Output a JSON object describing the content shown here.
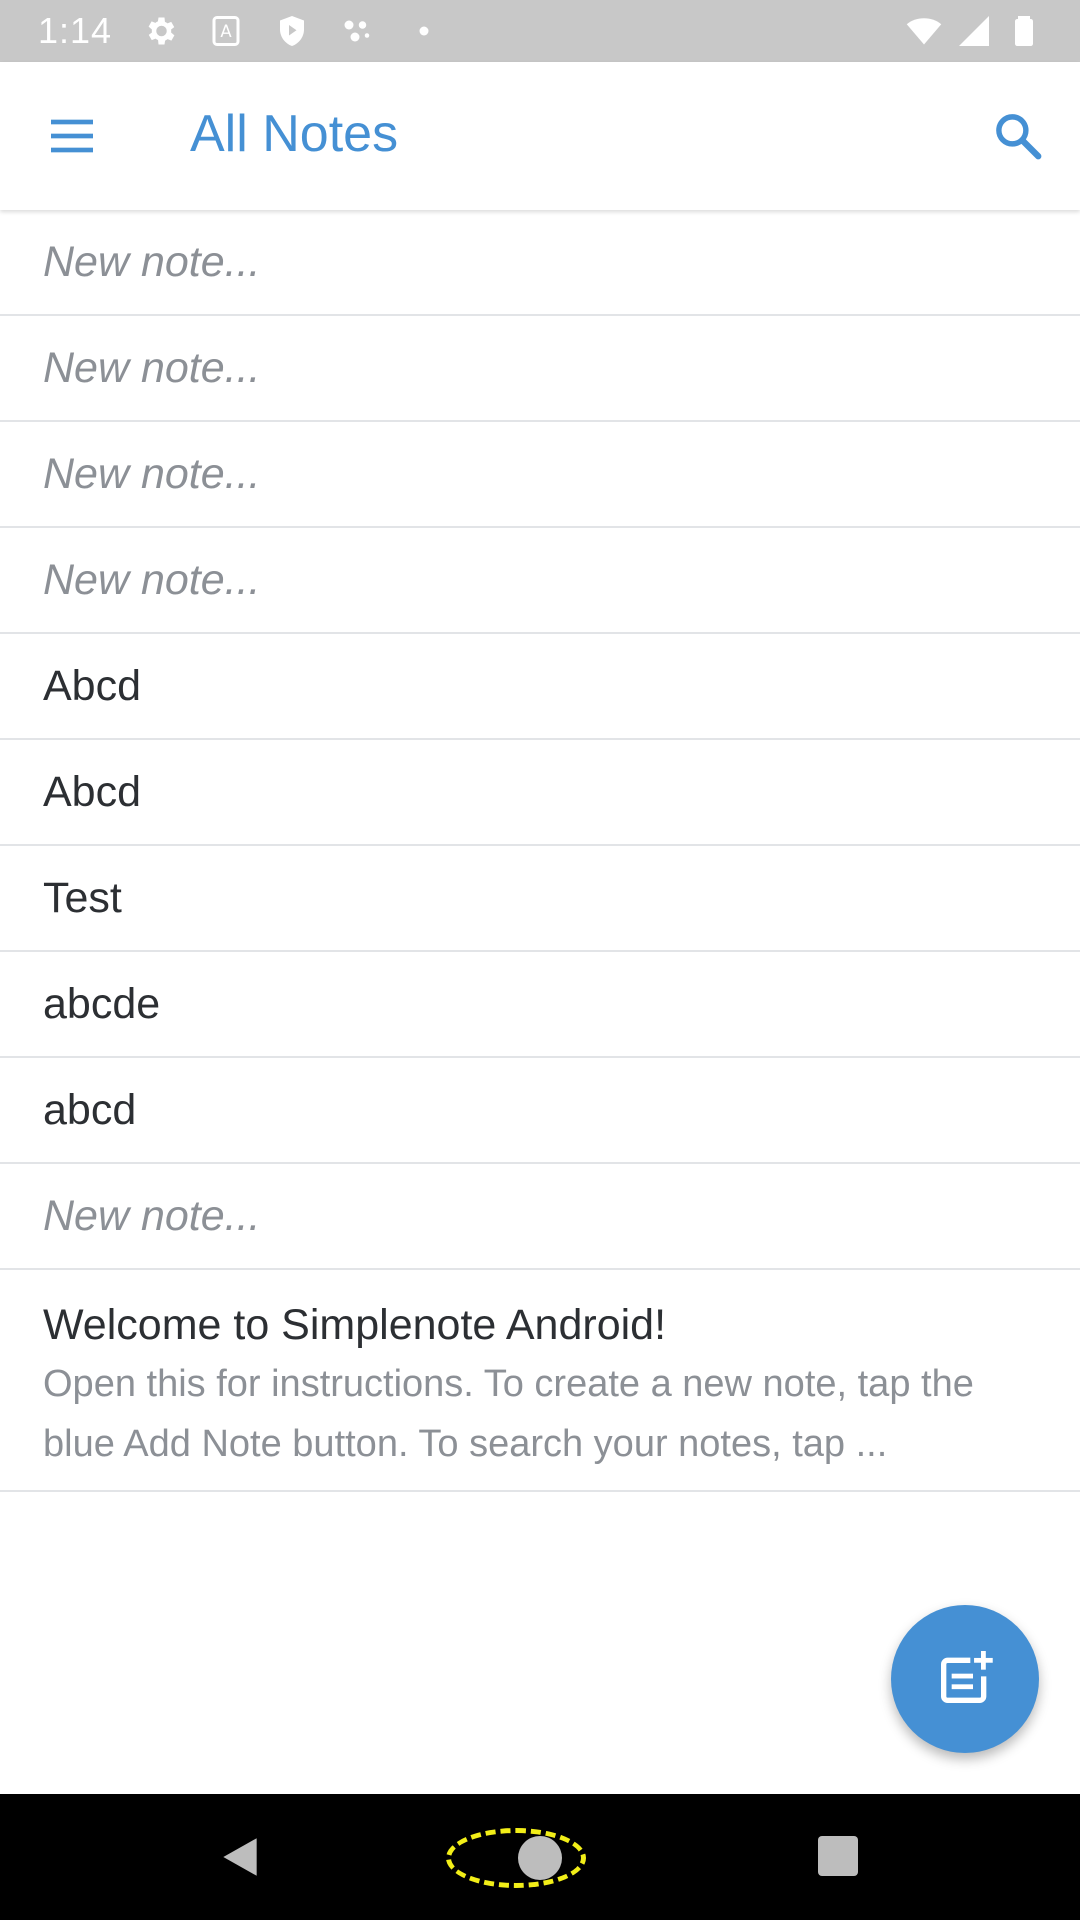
{
  "status_bar": {
    "time": "1:14",
    "icons": [
      "settings-icon",
      "a-icon",
      "shield-icon",
      "dots-icon",
      "dot-icon",
      "wifi-icon",
      "signal-icon",
      "battery-icon"
    ]
  },
  "app_bar": {
    "title": "All Notes",
    "accent_color": "#4590d4"
  },
  "notes": [
    {
      "title": "New note...",
      "placeholder": true
    },
    {
      "title": "New note...",
      "placeholder": true
    },
    {
      "title": "New note...",
      "placeholder": true
    },
    {
      "title": "New note...",
      "placeholder": true
    },
    {
      "title": "Abcd",
      "placeholder": false
    },
    {
      "title": "Abcd",
      "placeholder": false
    },
    {
      "title": "Test",
      "placeholder": false
    },
    {
      "title": "abcde",
      "placeholder": false
    },
    {
      "title": "abcd",
      "placeholder": false
    },
    {
      "title": "New note...",
      "placeholder": true
    },
    {
      "title": "Welcome to Simplenote Android!",
      "placeholder": false,
      "preview": "Open this for instructions. To create a new note, tap the blue Add Note button. To search your notes, tap ..."
    }
  ],
  "fab": {
    "icon": "add-note-icon"
  },
  "nav_bar": {
    "buttons": [
      "back",
      "home",
      "recents"
    ]
  }
}
